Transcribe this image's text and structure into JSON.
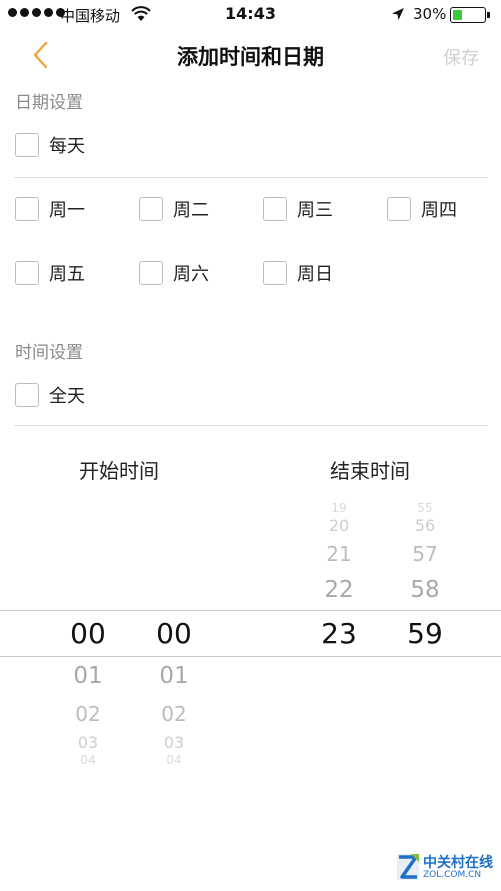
{
  "status_bar": {
    "carrier": "中国移动",
    "time": "14:43",
    "battery": "30%",
    "battery_level": 0.3
  },
  "nav": {
    "title": "添加时间和日期",
    "save_label": "保存"
  },
  "date_settings": {
    "label": "日期设置",
    "everyday": "每天",
    "weekdays": [
      "周一",
      "周二",
      "周三",
      "周四",
      "周五",
      "周六",
      "周日"
    ]
  },
  "time_settings": {
    "label": "时间设置",
    "allday": "全天"
  },
  "picker": {
    "start_label": "开始时间",
    "end_label": "结束时间",
    "start_hour": {
      "selected": "00",
      "below": [
        "01",
        "02",
        "03",
        "04"
      ]
    },
    "start_minute": {
      "selected": "00",
      "below": [
        "01",
        "02",
        "03",
        "04"
      ]
    },
    "end_hour": {
      "above": [
        "19",
        "20",
        "21",
        "22"
      ],
      "selected": "23"
    },
    "end_minute": {
      "above": [
        "55",
        "56",
        "57",
        "58"
      ],
      "selected": "59"
    }
  },
  "watermark": {
    "name": "中关村在线",
    "site": "ZOL.COM.CN"
  },
  "colors": {
    "accent": "#f0a23b",
    "battery": "#3cc83c",
    "watermark": "#1f6fc9"
  }
}
